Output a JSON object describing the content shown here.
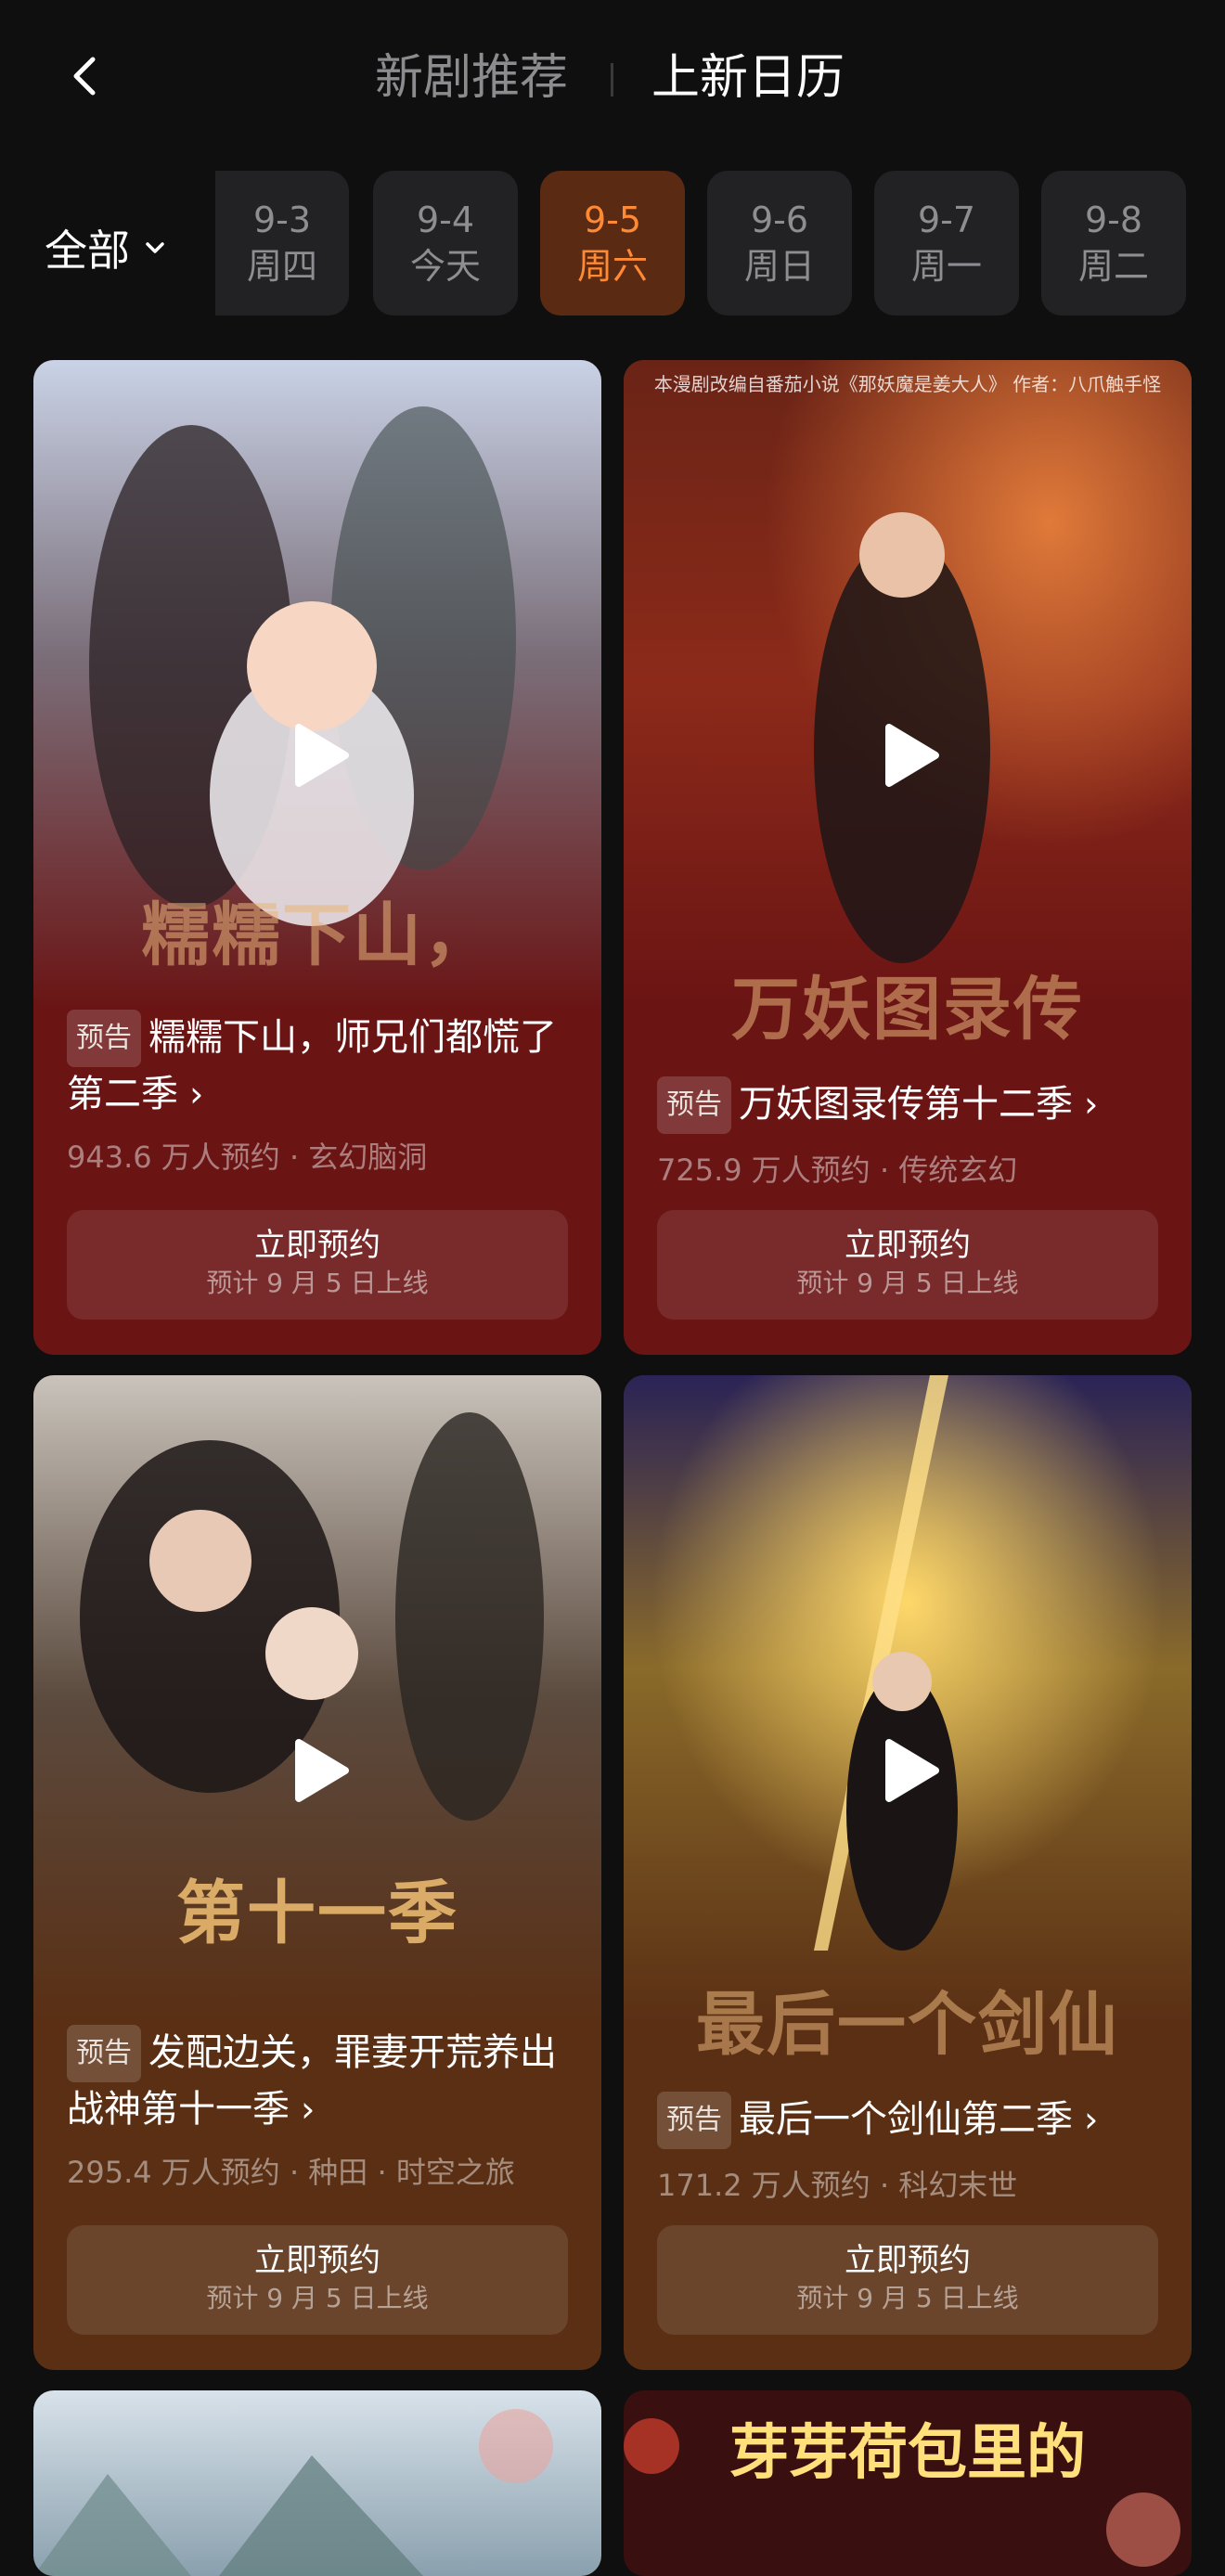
{
  "header": {
    "tab_recommend": "新剧推荐",
    "tab_calendar": "上新日历"
  },
  "filter": {
    "all_label": "全部"
  },
  "dates": [
    {
      "date": "9-3",
      "day": "周四"
    },
    {
      "date": "9-4",
      "day": "今天"
    },
    {
      "date": "9-5",
      "day": "周六"
    },
    {
      "date": "9-6",
      "day": "周日"
    },
    {
      "date": "9-7",
      "day": "周一"
    },
    {
      "date": "9-8",
      "day": "周二"
    }
  ],
  "active_date": "9-5",
  "cards": [
    {
      "tag": "预告",
      "title": "糯糯下山，师兄们都慌了第二季",
      "poster_title": "糯糯下山，",
      "meta": "943.6 万人预约 · 玄幻脑洞",
      "button_label": "立即预约",
      "button_sub": "预计 9 月 5 日上线",
      "bg_color": "#6a1414"
    },
    {
      "tag": "预告",
      "title": "万妖图录传第十二季",
      "poster_title": "万妖图录传",
      "poster_credit": "本漫剧改编自番茄小说《那妖魔是姜大人》 作者：八爪触手怪",
      "meta": "725.9 万人预约 · 传统玄幻",
      "button_label": "立即预约",
      "button_sub": "预计 9 月 5 日上线",
      "bg_color": "#6a1414"
    },
    {
      "tag": "预告",
      "title": "发配边关，罪妻开荒养出战神第十一季",
      "poster_title": "第十一季",
      "meta": "295.4 万人预约 · 种田 · 时空之旅",
      "button_label": "立即预约",
      "button_sub": "预计 9 月 5 日上线",
      "bg_color": "#5a2f14"
    },
    {
      "tag": "预告",
      "title": "最后一个剑仙第二季",
      "poster_title": "最后一个剑仙",
      "meta": "171.2 万人预约 · 科幻末世",
      "button_label": "立即预约",
      "button_sub": "预计 9 月 5 日上线",
      "bg_color": "#5a2f14"
    }
  ],
  "peek_cards": [
    {
      "poster_title": ""
    },
    {
      "poster_title": "芽芽荷包里的"
    }
  ]
}
